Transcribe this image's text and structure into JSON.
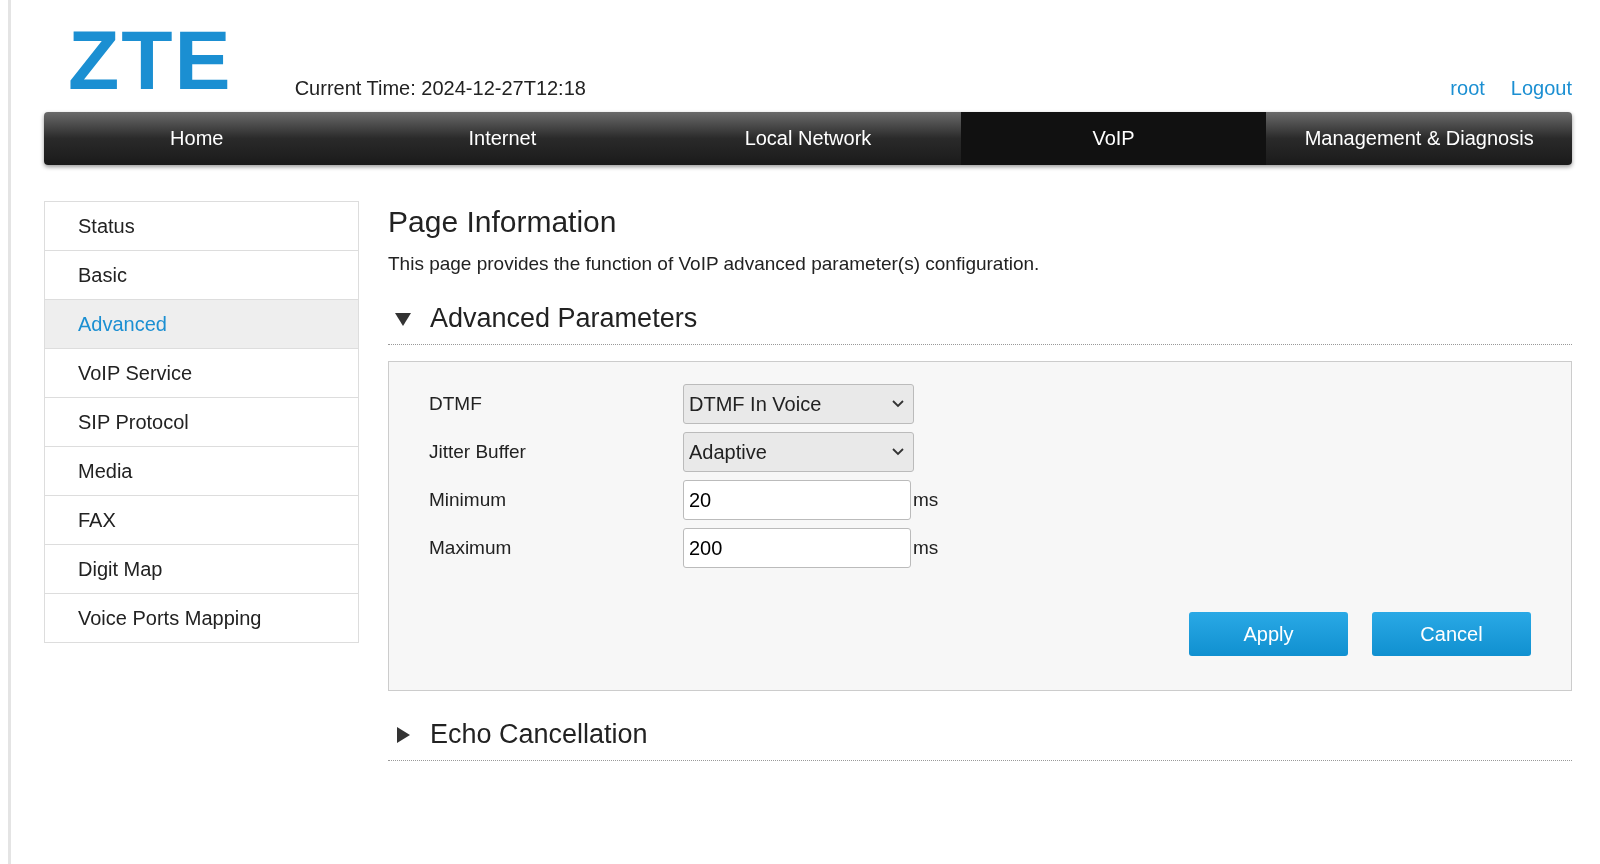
{
  "header": {
    "logo": "ZTE",
    "current_time": "Current Time: 2024-12-27T12:18",
    "user": "root",
    "logout": "Logout"
  },
  "nav": [
    {
      "label": "Home",
      "selected": false
    },
    {
      "label": "Internet",
      "selected": false
    },
    {
      "label": "Local Network",
      "selected": false
    },
    {
      "label": "VoIP",
      "selected": true
    },
    {
      "label": "Management & Diagnosis",
      "selected": false
    }
  ],
  "sidebar": [
    {
      "label": "Status",
      "selected": false
    },
    {
      "label": "Basic",
      "selected": false
    },
    {
      "label": "Advanced",
      "selected": true
    },
    {
      "label": "VoIP Service",
      "selected": false
    },
    {
      "label": "SIP Protocol",
      "selected": false
    },
    {
      "label": "Media",
      "selected": false
    },
    {
      "label": "FAX",
      "selected": false
    },
    {
      "label": "Digit Map",
      "selected": false
    },
    {
      "label": "Voice Ports Mapping",
      "selected": false
    }
  ],
  "page_info": {
    "title": "Page Information",
    "description": "This page provides the function of VoIP advanced parameter(s) configuration."
  },
  "sections": [
    {
      "title": "Advanced Parameters",
      "expanded": true,
      "fields": [
        {
          "kind": "select",
          "label": "DTMF",
          "value": "DTMF In Voice"
        },
        {
          "kind": "select",
          "label": "Jitter Buffer",
          "value": "Adaptive"
        },
        {
          "kind": "input",
          "label": "Minimum",
          "value": "20",
          "unit": "ms"
        },
        {
          "kind": "input",
          "label": "Maximum",
          "value": "200",
          "unit": "ms"
        }
      ],
      "buttons": [
        "Apply",
        "Cancel"
      ]
    },
    {
      "title": "Echo Cancellation",
      "expanded": false
    }
  ]
}
